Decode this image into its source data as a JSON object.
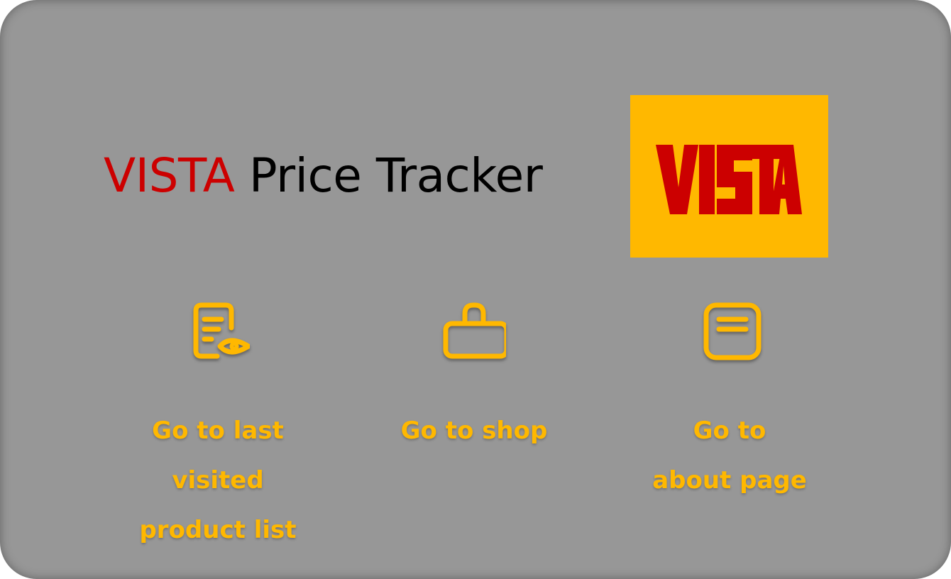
{
  "header": {
    "title_brand": "VISTA",
    "title_rest": "Price Tracker"
  },
  "logo": {
    "text": "VISTA",
    "background": "#ffb800",
    "text_color": "#cc0000"
  },
  "actions": [
    {
      "icon": "document-eye-icon",
      "label_lines": [
        "Go to last",
        "visited",
        "product list"
      ]
    },
    {
      "icon": "shopping-bag-icon",
      "label_lines": [
        "Go to shop"
      ]
    },
    {
      "icon": "note-icon",
      "label_lines": [
        "Go to",
        "about page"
      ]
    }
  ],
  "colors": {
    "card_background": "#979797",
    "accent": "#ffb800",
    "brand_red": "#cc0000"
  }
}
